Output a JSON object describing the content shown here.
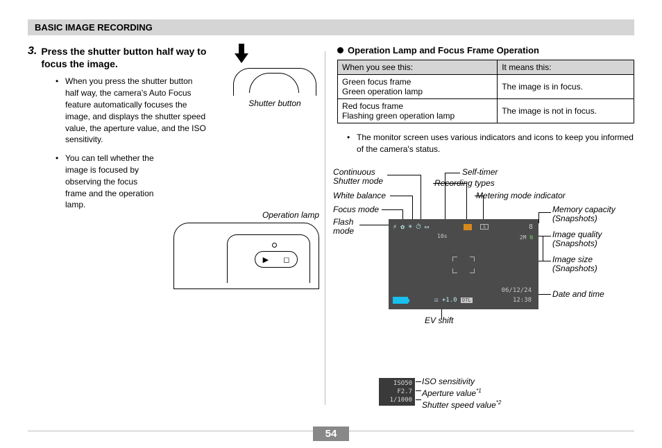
{
  "header": "BASIC IMAGE RECORDING",
  "step": {
    "num": "3.",
    "title": "Press the shutter button half way to focus the image.",
    "bullets": [
      "When you press the shutter button half way, the camera's Auto Focus feature automatically focuses the image, and displays the shutter speed value, the aperture value, and the ISO sensitivity.",
      "You can tell whether the image is focused by observing the focus frame and the operation lamp."
    ]
  },
  "shutter_caption": "Shutter button",
  "oplamp_caption": "Operation lamp",
  "right": {
    "title": "Operation Lamp and Focus Frame Operation",
    "table": {
      "h1": "When you see this:",
      "h2": "It means this:",
      "rows": [
        {
          "see1": "Green focus frame",
          "see2": "Green operation lamp",
          "meaning": "The image is in focus."
        },
        {
          "see1": "Red focus frame",
          "see2": "Flashing green operation lamp",
          "meaning": "The image is not in focus."
        }
      ]
    },
    "bullet": "The monitor screen uses various indicators and icons to keep you informed of the camera's status."
  },
  "labels": {
    "cont_shutter": "Continuous\nShutter mode",
    "white_balance": "White balance",
    "focus_mode": "Focus mode",
    "flash_mode": "Flash\nmode",
    "self_timer": "Self-timer",
    "recording_types": "Recording types",
    "metering": "Metering mode indicator",
    "mem_capacity": "Memory capacity\n(Snapshots)",
    "image_quality": "Image quality\n(Snapshots)",
    "image_size": "Image size\n(Snapshots)",
    "date_time": "Date and time",
    "ev_shift": "EV shift",
    "iso": "ISO sensitivity",
    "aperture": "Aperture value",
    "aperture_sup": "*1",
    "shutter_speed": "Shutter speed value",
    "shutter_sup": "*2"
  },
  "monitor": {
    "ten_s": "10s",
    "eight": "8",
    "qual_pre": "2M ",
    "qual_N": "N",
    "date": "06/12/24",
    "time": "12:38",
    "ev": "☑ +1.0",
    "dtl": "DTL",
    "sq": "S"
  },
  "iso_box": {
    "iso": "ISO50",
    "aperture": "F2.7",
    "shutter": "1/1000"
  },
  "page": "54"
}
